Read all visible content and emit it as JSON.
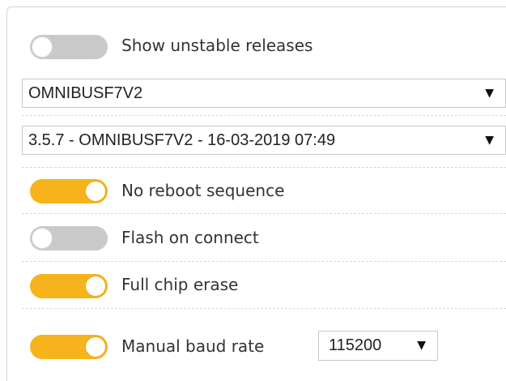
{
  "options": {
    "show_unstable": {
      "label": "Show unstable releases",
      "enabled": false
    },
    "board_select": {
      "value": "OMNIBUSF7V2"
    },
    "firmware_select": {
      "value": "3.5.7 - OMNIBUSF7V2 - 16-03-2019 07:49"
    },
    "no_reboot": {
      "label": "No reboot sequence",
      "enabled": true
    },
    "flash_on_connect": {
      "label": "Flash on connect",
      "enabled": false
    },
    "full_chip_erase": {
      "label": "Full chip erase",
      "enabled": true
    },
    "manual_baud": {
      "label": "Manual baud rate",
      "enabled": true,
      "value": "115200"
    }
  },
  "icons": {
    "dropdown": "▼"
  },
  "colors": {
    "toggle_on": "#f7b31b",
    "toggle_off": "#c9c9c9"
  }
}
